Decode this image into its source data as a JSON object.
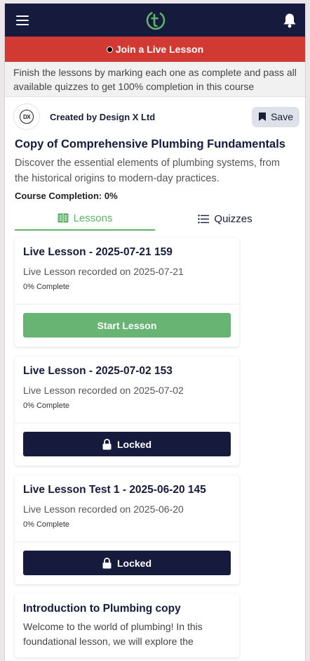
{
  "header": {
    "menu_icon": "hamburger-icon",
    "logo_icon": "brand-logo-icon",
    "bell_icon": "bell-icon",
    "brand_color": "#161b3d",
    "accent_color": "#5db468"
  },
  "banner": {
    "label": "Join a Live Lesson",
    "color": "#d13a33"
  },
  "notice": {
    "text": "Finish the lessons by marking each one as complete and pass all available quizzes to get 100% completion in this course"
  },
  "creator": {
    "avatar_text": "DX",
    "label": "Created by Design X Ltd",
    "save_label": "Save"
  },
  "course": {
    "title": "Copy of Comprehensive Plumbing Fundamentals",
    "description": "Discover the essential elements of plumbing systems, from the historical origins to modern-day practices.",
    "completion": "Course Completion: 0%"
  },
  "tabs": [
    {
      "label": "Lessons",
      "active": true,
      "icon": "book-icon"
    },
    {
      "label": "Quizzes",
      "active": false,
      "icon": "list-icon"
    }
  ],
  "lessons": [
    {
      "title": "Live Lesson - 2025-07-21 159",
      "subtitle": "Live Lesson recorded on 2025-07-21",
      "progress": "0% Complete",
      "button": "Start Lesson"
    },
    {
      "title": "Live Lesson - 2025-07-02 153",
      "subtitle": "Live Lesson recorded on 2025-07-02",
      "progress": "0% Complete",
      "button": "Locked"
    },
    {
      "title": "Live Lesson Test 1 - 2025-06-20 145",
      "subtitle": "Live Lesson recorded on 2025-06-20",
      "progress": "0% Complete",
      "button": "Locked"
    },
    {
      "title": "Introduction to Plumbing copy",
      "description": "Welcome to the world of plumbing! In this foundational lesson, we will explore the"
    }
  ]
}
